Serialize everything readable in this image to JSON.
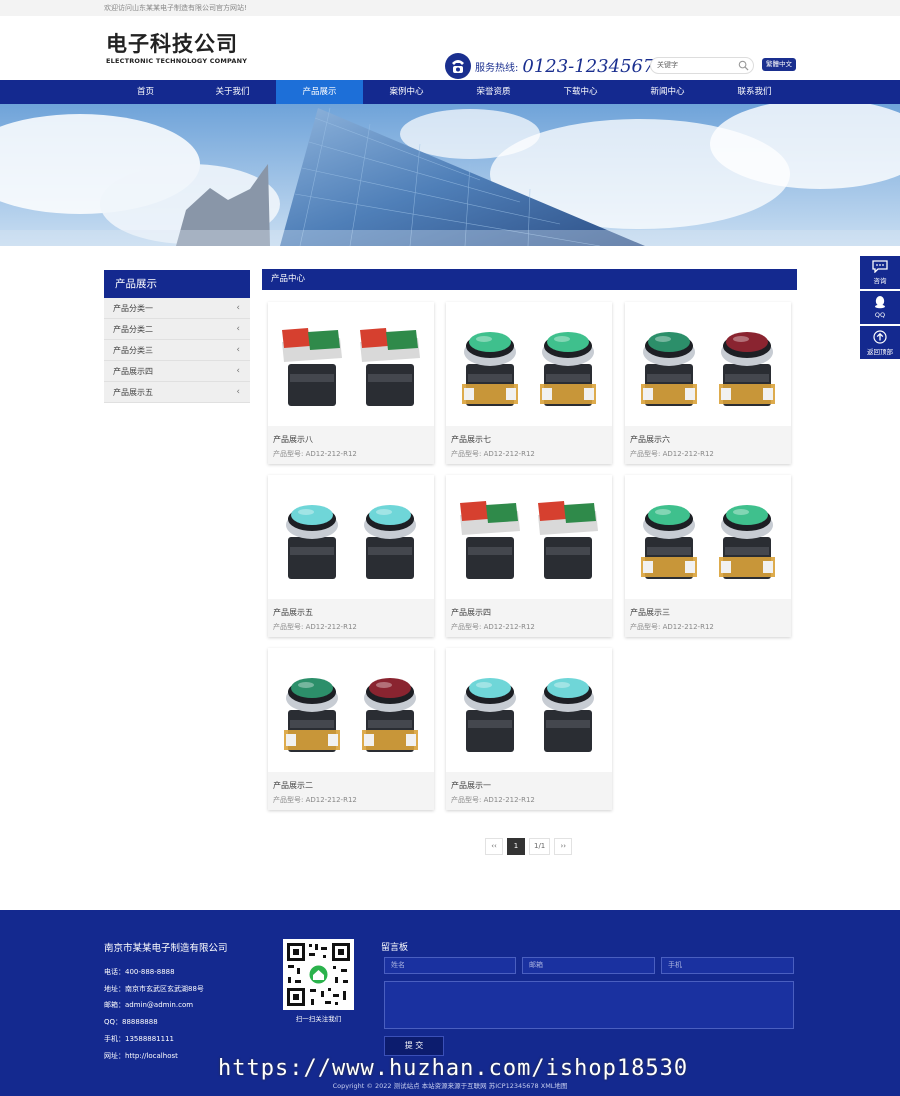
{
  "topbar": {
    "welcome": "欢迎访问山东某某电子制造有限公司官方网站!"
  },
  "header": {
    "logo_cn": "电子科技公司",
    "logo_en": "ELECTRONIC TECHNOLOGY COMPANY",
    "hotline_label": "服务热线:",
    "hotline_number": "0123-1234567",
    "search_placeholder": "关键字",
    "lang_button": "繁體中文"
  },
  "nav": {
    "items": [
      "首页",
      "关于我们",
      "产品展示",
      "案例中心",
      "荣誉资质",
      "下载中心",
      "新闻中心",
      "联系我们"
    ],
    "active_index": 2
  },
  "sidebar": {
    "title": "产品展示",
    "items": [
      "产品分类一",
      "产品分类二",
      "产品分类三",
      "产品展示四",
      "产品展示五"
    ]
  },
  "content": {
    "heading": "产品中心",
    "products": [
      {
        "name": "产品展示八",
        "model": "产品型号: AD12-212-R12",
        "style": "square-rg"
      },
      {
        "name": "产品展示七",
        "model": "产品型号: AD12-212-R12",
        "style": "round-green"
      },
      {
        "name": "产品展示六",
        "model": "产品型号: AD12-212-R12",
        "style": "round-gr-red"
      },
      {
        "name": "产品展示五",
        "model": "产品型号: AD12-212-R12",
        "style": "round-cyan"
      },
      {
        "name": "产品展示四",
        "model": "产品型号: AD12-212-R12",
        "style": "square-rg"
      },
      {
        "name": "产品展示三",
        "model": "产品型号: AD12-212-R12",
        "style": "round-green"
      },
      {
        "name": "产品展示二",
        "model": "产品型号: AD12-212-R12",
        "style": "round-gr-red"
      },
      {
        "name": "产品展示一",
        "model": "产品型号: AD12-212-R12",
        "style": "round-cyan"
      }
    ]
  },
  "pager": {
    "prev": "‹‹",
    "current": "1",
    "total": "1/1",
    "next": "››"
  },
  "float_bar": {
    "consult": "咨询",
    "qq": "QQ",
    "top": "返回顶部"
  },
  "footer": {
    "company": "南京市某某电子制造有限公司",
    "contact": [
      "电话：400-888-8888",
      "地址：南京市玄武区玄武湖88号",
      "邮箱：admin@admin.com",
      "QQ：88888888",
      "手机：13588881111",
      "网址：http://localhost"
    ],
    "qr_caption": "扫一扫关注我们",
    "message_title": "留言板",
    "name_placeholder": "姓名",
    "email_placeholder": "邮箱",
    "phone_placeholder": "手机",
    "submit": "提 交",
    "copyright": "Copyright © 2022 测试站点 本站资源来源于互联网 苏ICP12345678 XML地图"
  },
  "watermark": "https://www.huzhan.com/ishop18530",
  "colors": {
    "brand": "#14298f",
    "active_nav": "#1d6fd8"
  }
}
